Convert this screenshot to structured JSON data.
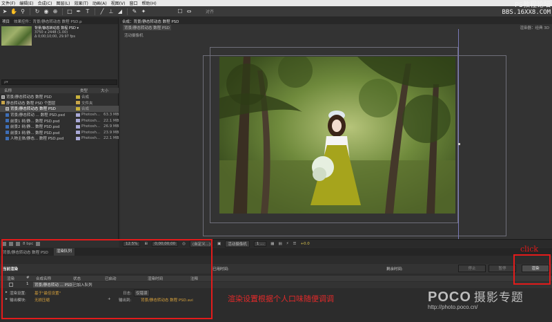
{
  "menubar": {
    "items": [
      "文件(F)",
      "编辑(E)",
      "合成(C)",
      "图层(L)",
      "效果(T)",
      "动画(A)",
      "视图(V)",
      "窗口",
      "帮助(H)"
    ]
  },
  "toolbar": {
    "tools": [
      "selection-tool",
      "hand-tool",
      "zoom-tool",
      "rotate-tool",
      "camera-tool",
      "pan-behind-tool",
      "rectangle-tool",
      "pen-tool",
      "type-tool",
      "brush-tool",
      "clone-tool",
      "eraser-tool",
      "roto-brush-tool",
      "puppet-tool"
    ],
    "align_label": "对齐"
  },
  "watermark": {
    "site": "PS教程论坛",
    "url": "BBS.16XX8.COM"
  },
  "project": {
    "tabs": [
      "项目",
      "效果控件：背景/静态转动态 数程 PSD.p"
    ],
    "comp_name": "背景/静态转动态 数程 PSD ▾",
    "comp_size": "3750 x 2448 (1.00)",
    "comp_duration": "Δ 0;00;10;00, 29.97 fps",
    "search_placeholder": "ρ▾",
    "columns": [
      "名称",
      "类型",
      "大小"
    ],
    "rows": [
      {
        "name": "背景/静态转动态 数程 PSD",
        "type": "合成",
        "size": "",
        "icon": "comp",
        "swatch": "#c9b23c",
        "selected": false
      },
      {
        "name": "静态转动态 数程 PSD 个图层",
        "type": "文件夹",
        "size": "",
        "icon": "folder",
        "swatch": "#c9a64a",
        "selected": false
      },
      {
        "name": "背景/静态转动态 数程 PSD",
        "type": "合成",
        "size": "",
        "icon": "comp",
        "swatch": "#c9b23c",
        "selected": true
      },
      {
        "name": "背景/静态转动 ... 数程 PSD.psd",
        "type": "Photosh...",
        "size": "63.3 MB",
        "icon": "psd",
        "swatch": "#a9a9d6",
        "selected": false
      },
      {
        "name": "前景1 树/静... 数程 PSD.psd",
        "type": "Photosh...",
        "size": "22.1 MB",
        "icon": "psd",
        "swatch": "#a9a9d6",
        "selected": false
      },
      {
        "name": "前景2 树/静... 数程 PSD.psd",
        "type": "Photosh...",
        "size": "26.9 MB",
        "icon": "psd",
        "swatch": "#a9a9d6",
        "selected": false
      },
      {
        "name": "前景3 树/静... 数程 PSD.psd",
        "type": "Photosh...",
        "size": "23.9 MB",
        "icon": "psd",
        "swatch": "#a9a9d6",
        "selected": false
      },
      {
        "name": "人物主体/静态... 数程 PSD.psd",
        "type": "Photosh...",
        "size": "22.1 MB",
        "icon": "psd",
        "swatch": "#a9a9d6",
        "selected": false
      }
    ],
    "bpc": "8 bpc"
  },
  "viewer": {
    "tabs": [
      "合成：背景/静态转动态 数程 PSD"
    ],
    "breadcrumb": "背景/静态转动态 数程 PSD",
    "renderer_label": "渲染器：经典 3D",
    "camera_label": "活动摄像机",
    "zoom": "12.5%",
    "timecode": "0;00;00;00",
    "resolution": "(自定义...)",
    "view": "活动摄像机",
    "views": "1 ...",
    "exposure": "+0.0"
  },
  "render_queue": {
    "tabs": [
      "背景/静态转动态 数程 PSD",
      "渲染队列"
    ],
    "current_render": "当前渲染",
    "elapsed_label": "已用时间:",
    "remaining_label": "剩余时间:",
    "stop_label": "停止",
    "pause_label": "暂停",
    "render_label": "渲染",
    "columns": [
      "渲染",
      "#",
      "合成名称",
      "状态",
      "已启动",
      "渲染时间",
      "注释"
    ],
    "item": {
      "number": "1",
      "comp": "背景/静态转动 ... PSD",
      "status": "已加入队列"
    },
    "render_settings_label": "渲染设置:",
    "render_settings_value": "基于\"最佳设置\"",
    "log_label": "日志:",
    "log_value": "仅错误",
    "output_module_label": "输出模块:",
    "output_module_value": "无损压缩",
    "output_to_label": "输出到:",
    "output_to_value": "背景/静态转动态 数程 PSD.avi"
  },
  "annotations": {
    "click": "click",
    "caption": "渲染设置根据个人口味随便调调"
  },
  "poco": {
    "brand": "POCO",
    "section": "摄影专题",
    "url": "http://photo.poco.cn/"
  },
  "colors": {
    "annotation_red": "#e41b1b",
    "link_orange": "#d8a23c",
    "guide_purple": "#7a7ab8"
  }
}
